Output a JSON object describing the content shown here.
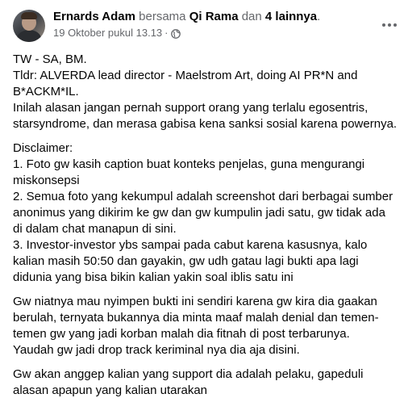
{
  "post": {
    "author": "Ernards Adam",
    "with_word": "bersama",
    "tagged_person": "Qi Rama",
    "and_word": "dan",
    "others": "4 lainnya",
    "period": ".",
    "timestamp": "19 Oktober pukul 13.13",
    "dot": "·",
    "privacy_icon": "globe-icon",
    "more_icon": "more-options-icon"
  },
  "body": {
    "paragraphs": [
      [
        "TW - SA, BM.",
        "Tldr: ALVERDA lead director - Maelstrom Art, doing AI PR*N and",
        "B*ACKM*IL.",
        "Inilah alasan jangan pernah support orang yang terlalu egosentris,",
        "starsyndrome, dan merasa gabisa kena sanksi sosial karena powernya."
      ],
      [
        "Disclaimer:",
        "1. Foto gw kasih caption buat konteks penjelas, guna mengurangi",
        "miskonsepsi",
        "2. Semua foto yang kekumpul adalah screenshot dari berbagai sumber",
        "anonimus yang dikirim ke gw dan gw kumpulin jadi satu, gw tidak ada",
        "di dalam chat manapun di sini.",
        "3. Investor-investor ybs sampai pada cabut karena kasusnya, kalo",
        "kalian masih 50:50 dan gayakin, gw udh gatau lagi bukti apa lagi",
        "didunia yang bisa bikin kalian yakin soal iblis satu ini"
      ],
      [
        "Gw niatnya mau nyimpen bukti ini sendiri karena gw kira dia gaakan",
        "berulah, ternyata bukannya dia minta maaf malah denial dan temen-",
        "temen gw yang jadi korban malah dia fitnah di post terbarunya.",
        "Yaudah gw jadi drop track keriminal nya dia aja disini."
      ],
      [
        "Gw akan anggep kalian yang support dia adalah pelaku, gapeduli",
        "alasan apapun yang kalian utarakan"
      ]
    ]
  }
}
